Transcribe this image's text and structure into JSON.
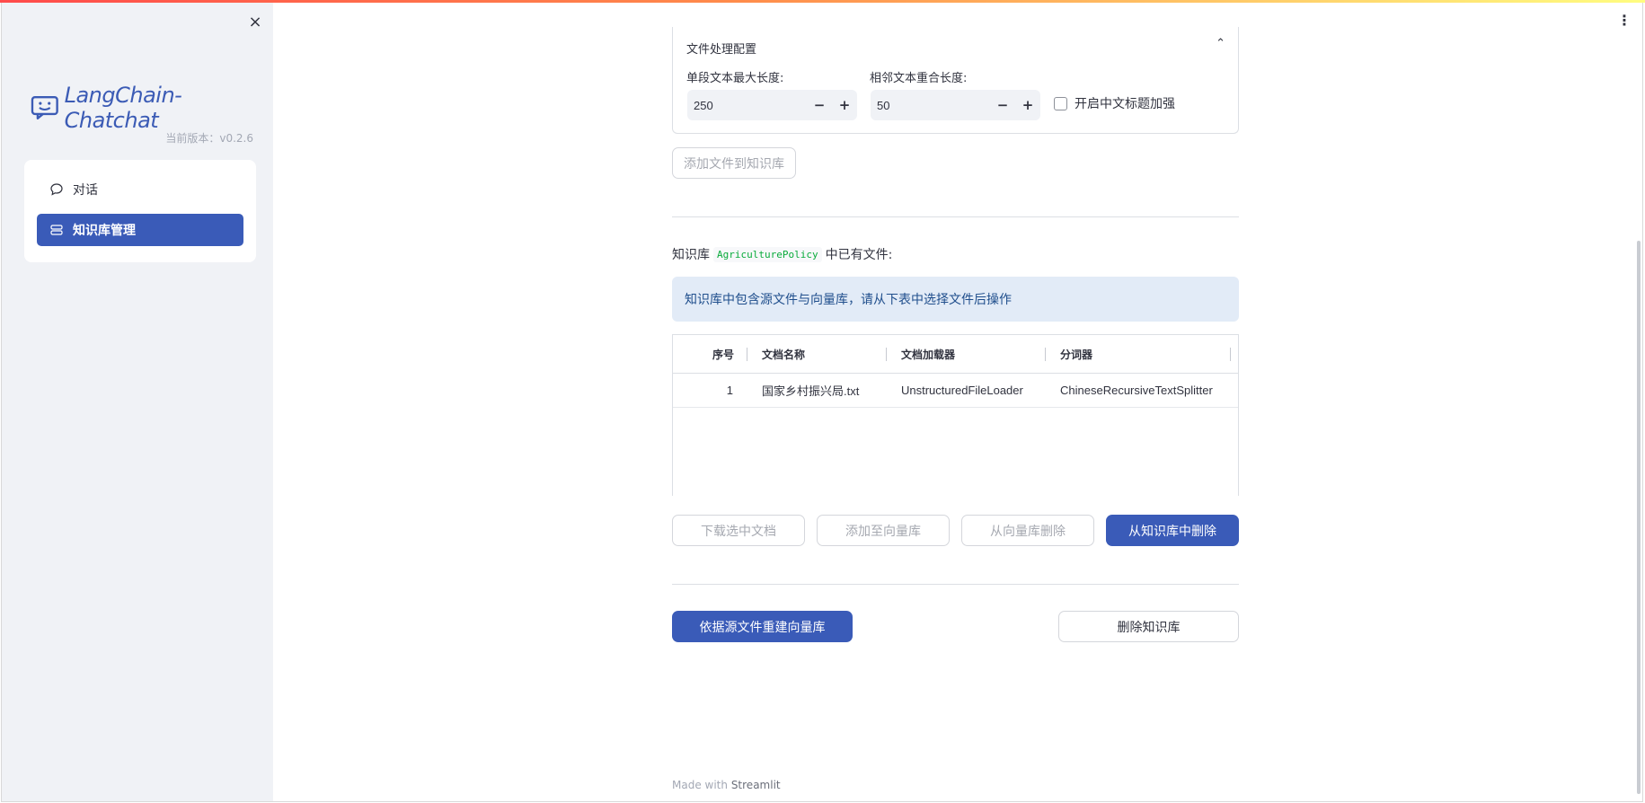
{
  "sidebar": {
    "close_icon": "×",
    "logo_text": "LangChain-Chatchat",
    "version": "当前版本：v0.2.6",
    "nav": [
      {
        "label": "对话",
        "icon": "chat-bubble-icon"
      },
      {
        "label": "知识库管理",
        "icon": "database-icon",
        "active": true
      }
    ]
  },
  "main": {
    "menu_icon": "⋮",
    "file_config": {
      "title": "文件处理配置",
      "collapse_icon": "⌃",
      "max_len_label": "单段文本最大长度:",
      "max_len_value": "250",
      "overlap_label": "相邻文本重合长度:",
      "overlap_value": "50",
      "zh_title_label": "开启中文标题加强",
      "zh_title_checked": false,
      "minus": "−",
      "plus": "+"
    },
    "add_files_button": "添加文件到知识库",
    "kb_prefix": "知识库",
    "kb_name": "AgriculturePolicy",
    "kb_suffix": "中已有文件:",
    "info": "知识库中包含源文件与向量库，请从下表中选择文件后操作",
    "table": {
      "headers": [
        "序号",
        "文档名称",
        "文档加载器",
        "分词器"
      ],
      "rows": [
        [
          "1",
          "国家乡村振兴局.txt",
          "UnstructuredFileLoader",
          "ChineseRecursiveTextSplitter"
        ]
      ]
    },
    "actions": {
      "download": "下载选中文档",
      "add_to_vs": "添加至向量库",
      "delete_from_vs": "从向量库删除",
      "delete_from_kb": "从知识库中删除"
    },
    "rebuild_button": "依据源文件重建向量库",
    "delete_kb_button": "删除知识库",
    "footer_prefix": "Made with",
    "footer_brand": "Streamlit"
  },
  "colors": {
    "primary": "#3a5bb8",
    "info_bg": "#e2ebf7",
    "sidebar_bg": "#f0f2f6"
  }
}
